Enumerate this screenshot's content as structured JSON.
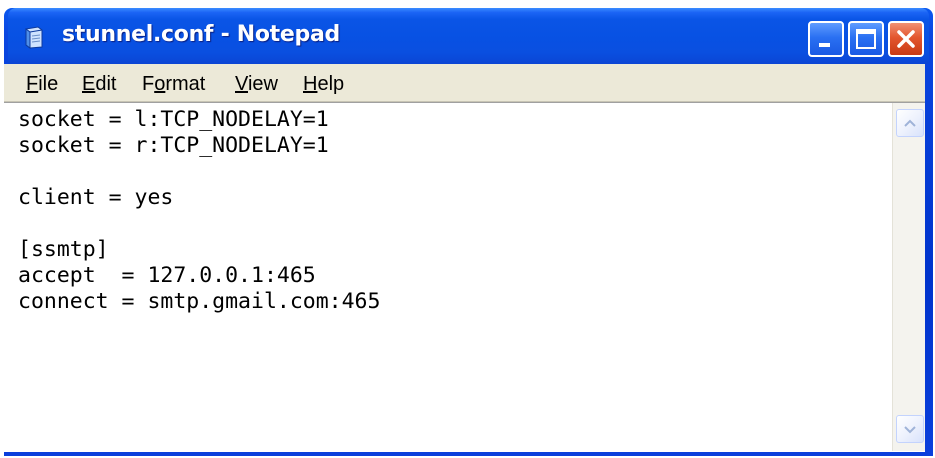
{
  "window": {
    "title": "stunnel.conf - Notepad",
    "app_icon": "notepad-icon",
    "controls": {
      "minimize_icon": "minimize-icon",
      "maximize_icon": "maximize-icon",
      "close_icon": "close-icon"
    }
  },
  "menubar": {
    "items": [
      {
        "first": "F",
        "rest": "ile"
      },
      {
        "first": "E",
        "rest": "dit"
      },
      {
        "pre": "F",
        "first": "o",
        "rest": "rmat"
      },
      {
        "first": "V",
        "rest": "iew"
      },
      {
        "first": "H",
        "rest": "elp"
      }
    ]
  },
  "editor": {
    "content": "socket = l:TCP_NODELAY=1\nsocket = r:TCP_NODELAY=1\n\nclient = yes\n\n[ssmtp]\naccept  = 127.0.0.1:465\nconnect = smtp.gmail.com:465"
  },
  "scrollbar": {
    "up_icon": "scroll-up-icon",
    "down_icon": "scroll-down-icon"
  }
}
